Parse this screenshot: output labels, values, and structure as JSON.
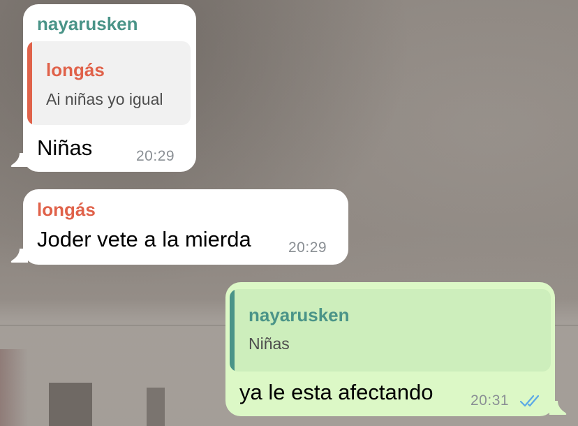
{
  "colors": {
    "incoming_bubble": "#ffffff",
    "outgoing_bubble": "#dcf8c6",
    "quote_in_bg": "#f1f1f1",
    "quote_out_bg": "#cdeebc",
    "name_nayarusken": "#4a9488",
    "name_longas": "#e0624a",
    "time_gray": "#8a8f94",
    "read_ticks": "#5aa8e6"
  },
  "messages": [
    {
      "sender": "nayarusken",
      "quote": {
        "author": "longás",
        "text": "Ai niñas yo igual"
      },
      "text": "Niñas",
      "time": "20:29"
    },
    {
      "sender": "longás",
      "text": "Joder vete a la mierda",
      "time": "20:29"
    },
    {
      "quote": {
        "author": "nayarusken",
        "text": "Niñas"
      },
      "text": "ya le esta afectando",
      "time": "20:31",
      "status_icon": "double-check-read-icon"
    }
  ]
}
